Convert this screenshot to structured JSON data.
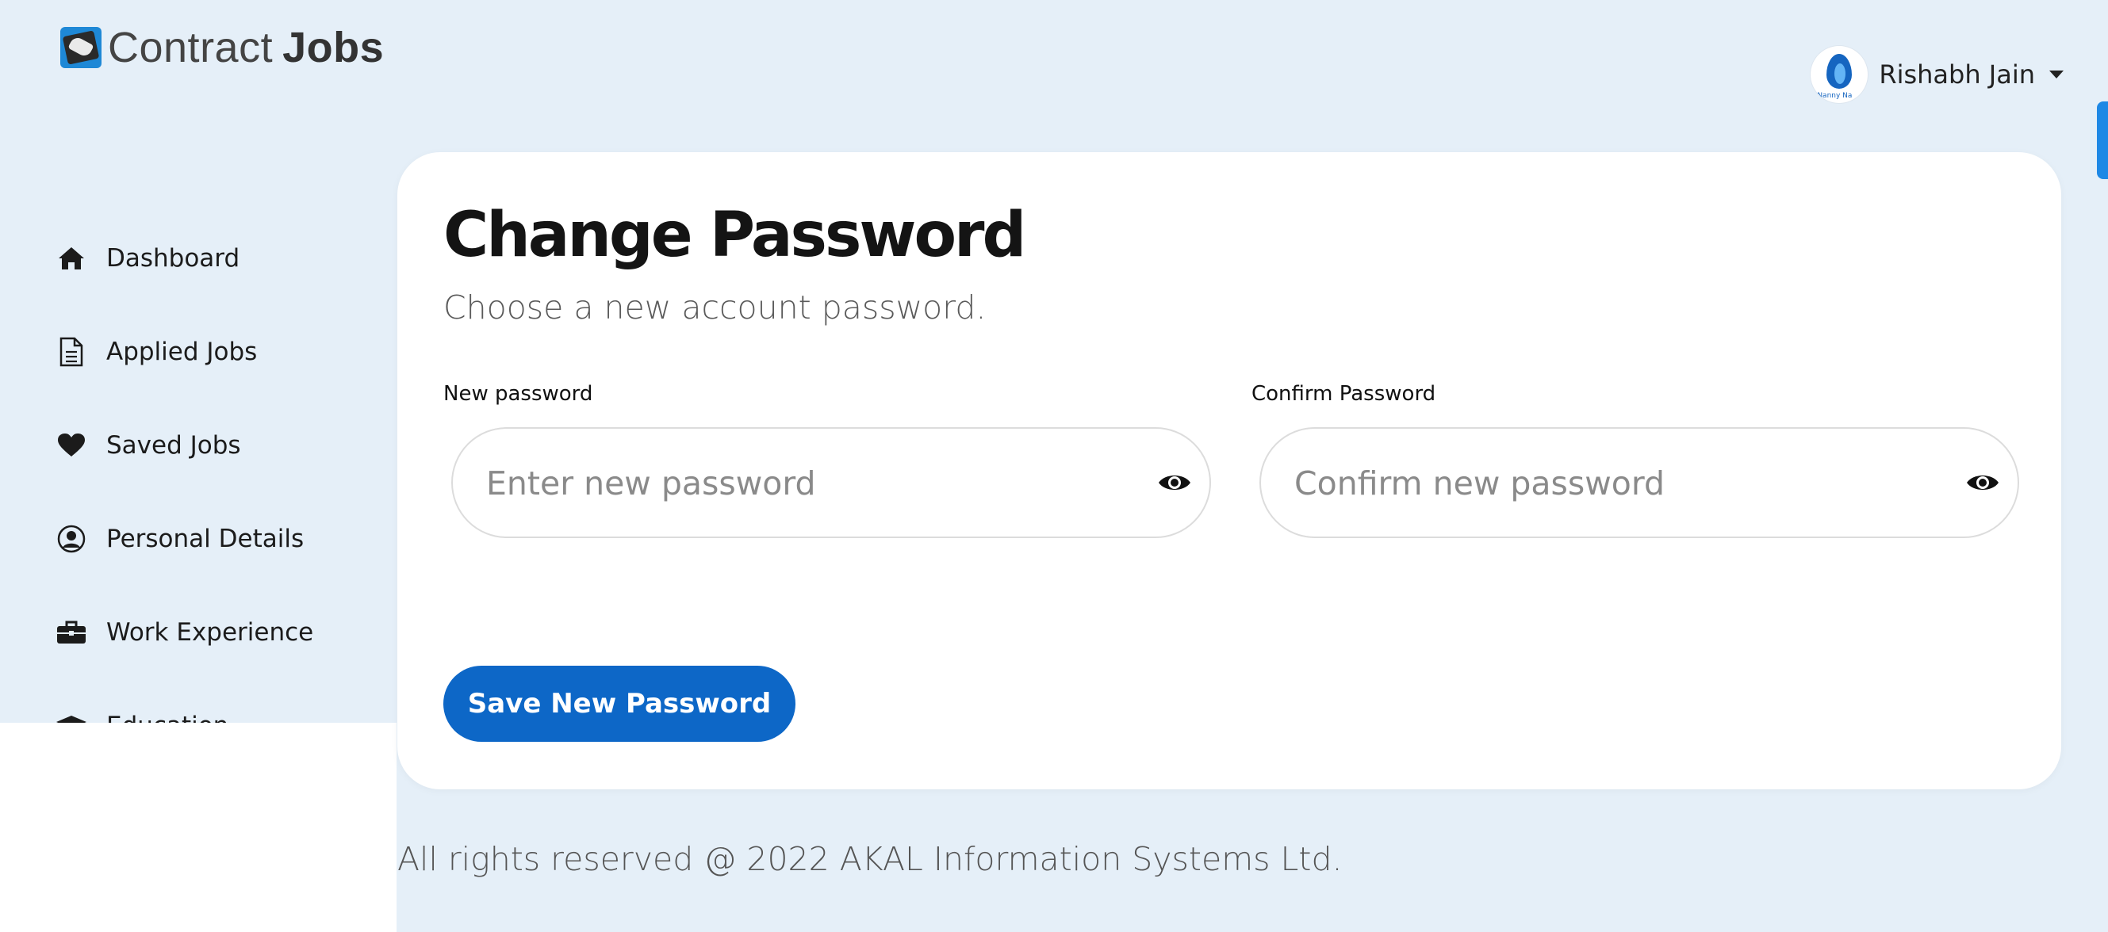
{
  "brand": {
    "name_light": "Contract",
    "name_bold": "Jobs",
    "logo_icon": "handshake-icon"
  },
  "user": {
    "name": "Rishabh Jain",
    "avatar_icon": "avatar-logo",
    "avatar_text": "Nanny Na"
  },
  "sidebar": {
    "items": [
      {
        "label": "Dashboard",
        "icon": "home-icon"
      },
      {
        "label": "Applied Jobs",
        "icon": "document-icon"
      },
      {
        "label": "Saved Jobs",
        "icon": "heart-icon"
      },
      {
        "label": "Personal Details",
        "icon": "user-circle-icon"
      },
      {
        "label": "Work Experience",
        "icon": "briefcase-icon"
      },
      {
        "label": "Education",
        "icon": "graduation-cap-icon"
      }
    ]
  },
  "page": {
    "title": "Change Password",
    "subtitle": "Choose a new account password.",
    "new_password": {
      "label": "New password",
      "placeholder": "Enter new password"
    },
    "confirm_password": {
      "label": "Confirm Password",
      "placeholder": "Confirm new password"
    },
    "save_label": "Save New Password"
  },
  "footer": {
    "text": "All rights reserved @ 2022 AKAL Information Systems Ltd."
  },
  "colors": {
    "background": "#e5eff8",
    "primary": "#0d67c7",
    "card": "#ffffff"
  }
}
